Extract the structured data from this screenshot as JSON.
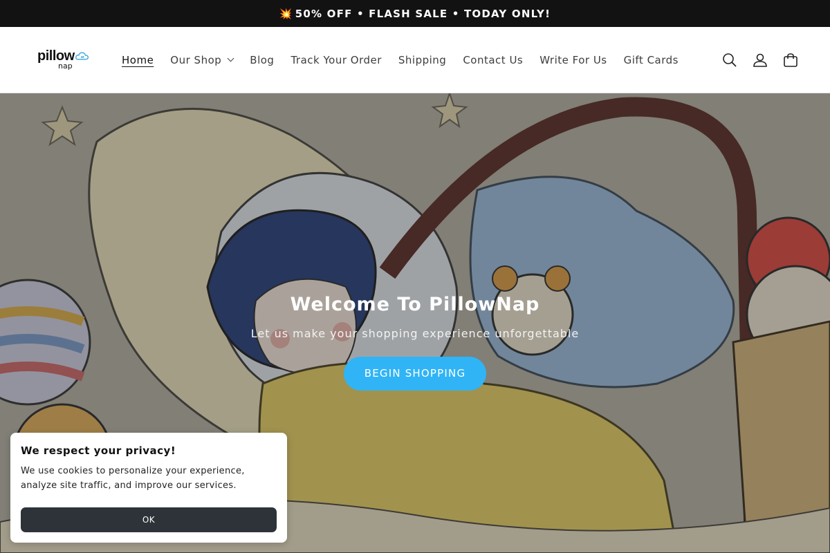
{
  "announcement": {
    "emoji": "💥",
    "text": "50% OFF • FLASH SALE • TODAY ONLY!"
  },
  "logo": {
    "line1": "pillow",
    "line2": "nap"
  },
  "nav": {
    "home": "Home",
    "shop": "Our Shop",
    "blog": "Blog",
    "track": "Track Your Order",
    "shipping": "Shipping",
    "contact": "Contact Us",
    "write": "Write For Us",
    "gift": "Gift Cards"
  },
  "icons": [
    "search-icon",
    "account-icon",
    "cart-icon"
  ],
  "hero": {
    "title": "Welcome To PillowNap",
    "subtitle": "Let us make your shopping experience unforgettable",
    "cta": "BEGIN SHOPPING"
  },
  "cookie": {
    "title": "We respect your privacy!",
    "body": "We use cookies to personalize your experience, analyze site traffic, and improve our services.",
    "ok": "OK"
  },
  "colors": {
    "accent": "#30b4f5",
    "announce_bg": "#121212",
    "cookie_button": "#2d3339"
  }
}
